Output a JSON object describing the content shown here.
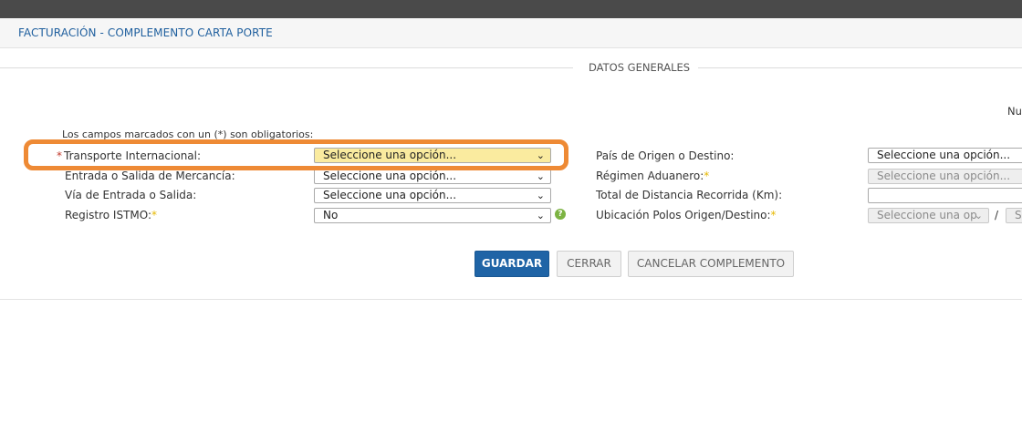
{
  "header": {
    "title": "FACTURACIÓN - COMPLEMENTO CARTA PORTE"
  },
  "section": {
    "title": "DATOS GENERALES",
    "truncated_right_label": "Nu"
  },
  "required_note": "Los campos marcados con un (*) son obligatorios:",
  "left_fields": [
    {
      "label": "Transporte Internacional:",
      "value": "Seleccione una opción...",
      "required": "*"
    },
    {
      "label": "Entrada o Salida de Mercancía:",
      "value": "Seleccione una opción..."
    },
    {
      "label": "Vía de Entrada o Salida:",
      "value": "Seleccione una opción..."
    },
    {
      "label": "Registro ISTMO:",
      "value": "No",
      "required": "*",
      "help_icon": "?"
    }
  ],
  "right_fields": [
    {
      "label": "País de Origen o Destino:",
      "value": "Seleccione una opción..."
    },
    {
      "label": "Régimen Aduanero:",
      "value": "Seleccione una opción...",
      "required": "*"
    },
    {
      "label": "Total de Distancia Recorrida (Km):",
      "value": ""
    },
    {
      "label": "Ubicación Polos Origen/Destino:",
      "value": "Seleccione una op",
      "value2": "Se",
      "separator": "/",
      "required": "*"
    }
  ],
  "buttons": {
    "save": "GUARDAR",
    "close": "CERRAR",
    "cancel": "CANCELAR COMPLEMENTO"
  },
  "icons": {
    "chevron": "chevron-down-icon"
  },
  "colors": {
    "accent": "#1f64a6",
    "highlight": "#ee8a35",
    "field_highlight": "#faeb9f",
    "required_star": "#e6b800"
  }
}
